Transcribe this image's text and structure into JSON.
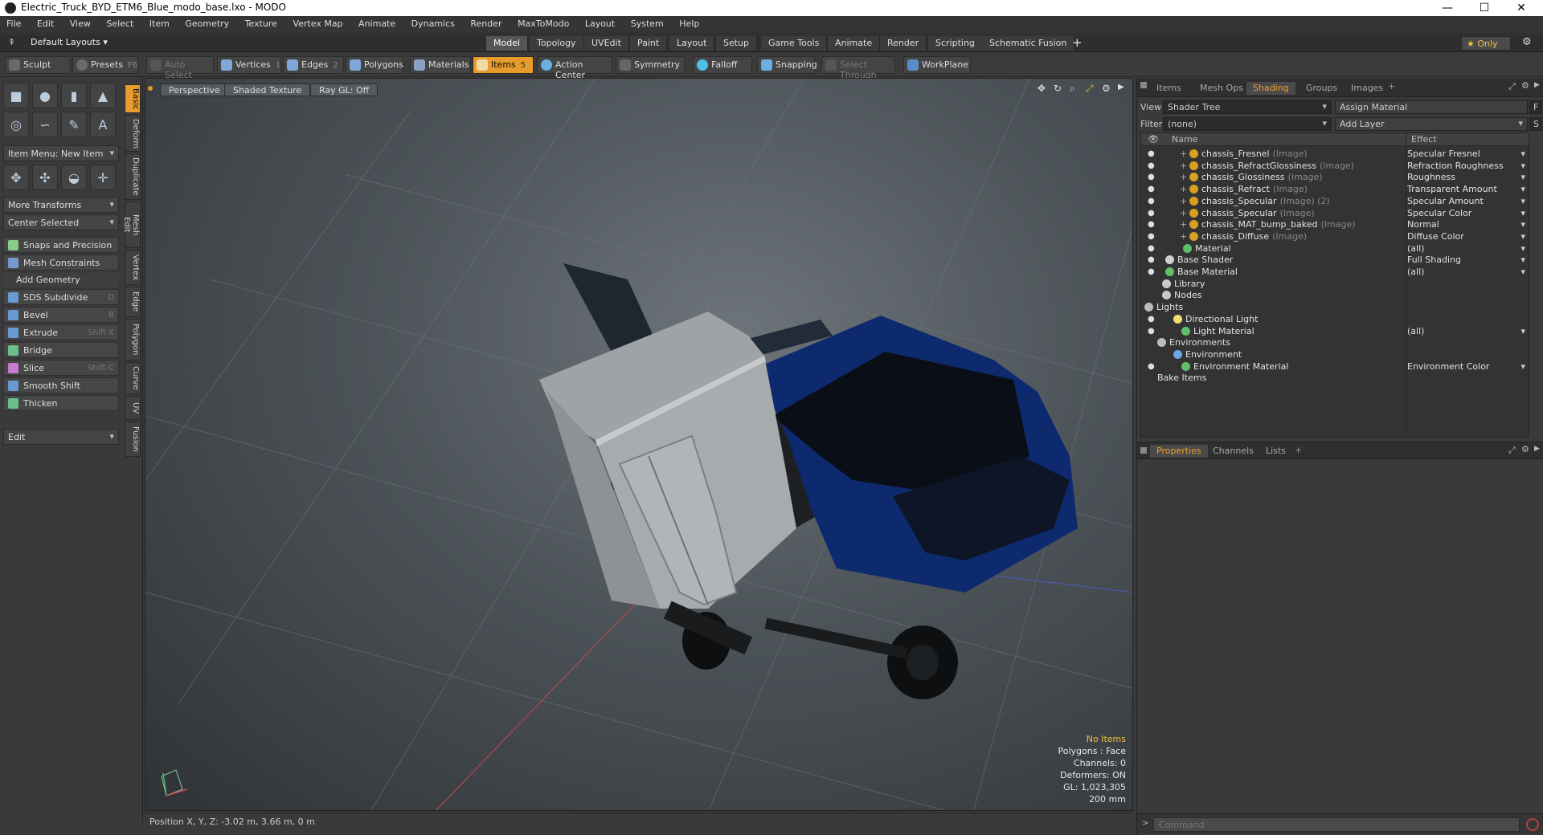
{
  "window": {
    "title": "Electric_Truck_BYD_ETM6_Blue_modo_base.lxo - MODO",
    "minimize": "—",
    "maximize": "☐",
    "close": "✕"
  },
  "menu": [
    "File",
    "Edit",
    "View",
    "Select",
    "Item",
    "Geometry",
    "Texture",
    "Vertex Map",
    "Animate",
    "Dynamics",
    "Render",
    "MaxToModo",
    "Layout",
    "System",
    "Help"
  ],
  "layouts": {
    "selector": "Default Layouts",
    "tabs": [
      "Model",
      "Topology",
      "UVEdit",
      "Paint",
      "Layout",
      "Setup",
      "Game Tools",
      "Animate",
      "Render",
      "Scripting",
      "Schematic Fusion"
    ],
    "active": "Model",
    "add": "+",
    "only": "★ Only"
  },
  "toolbar": {
    "sculpt": "Sculpt",
    "presets": "Presets",
    "presets_key": "F6",
    "auto_select": "Auto Select",
    "vertices": "Vertices",
    "vertices_n": "1",
    "edges": "Edges",
    "edges_n": "2",
    "polygons": "Polygons",
    "materials": "Materials",
    "items": "Items",
    "items_n": "5",
    "action_center": "Action Center",
    "symmetry": "Symmetry",
    "falloff": "Falloff",
    "snapping": "Snapping",
    "select_through": "Select Through",
    "workplane": "WorkPlane"
  },
  "left": {
    "item_menu": "Item Menu: New Item",
    "more_transforms": "More Transforms",
    "center_selected": "Center Selected",
    "snaps": "Snaps and Precision",
    "mesh_constraints": "Mesh Constraints",
    "add_geometry": "Add Geometry",
    "tools": [
      {
        "label": "SDS Subdivide",
        "key": "D"
      },
      {
        "label": "Bevel",
        "key": "B"
      },
      {
        "label": "Extrude",
        "key": "Shift-X"
      },
      {
        "label": "Bridge",
        "key": ""
      },
      {
        "label": "Slice",
        "key": "Shift-C"
      },
      {
        "label": "Smooth Shift",
        "key": ""
      },
      {
        "label": "Thicken",
        "key": ""
      }
    ],
    "edit": "Edit",
    "vtabs": [
      "Basic",
      "Deform",
      "Duplicate",
      "Mesh Edit",
      "Vertex",
      "Edge",
      "Polygon",
      "Curve",
      "UV",
      "Fusion"
    ]
  },
  "viewport": {
    "perspective": "Perspective",
    "shading": "Shaded Texture",
    "raygl": "Ray GL: Off",
    "hud": {
      "no_items": "No Items",
      "polygons": "Polygons : Face",
      "channels": "Channels: 0",
      "deformers": "Deformers: ON",
      "gl": "GL: 1,023,305",
      "scale": "200 mm"
    }
  },
  "status": {
    "position": "Position X, Y, Z:  -3.02 m, 3.66 m, 0 m"
  },
  "right": {
    "tabs": [
      "Items",
      "Mesh Ops",
      "Shading",
      "Groups",
      "Images"
    ],
    "active_tab": "Shading",
    "view_label": "View",
    "view_value": "Shader Tree",
    "assign_material": "Assign Material",
    "f_btn": "F",
    "filter_label": "Filter",
    "filter_value": "(none)",
    "add_layer": "Add Layer",
    "s_btn": "S",
    "col_name": "Name",
    "col_effect": "Effect",
    "rows": [
      {
        "name": "chassis_Fresnel",
        "sub": "(Image)",
        "effect": "Specular Fresnel",
        "eye": true,
        "plus": true,
        "icon": "image"
      },
      {
        "name": "chassis_RefractGlossiness",
        "sub": "(Image)",
        "effect": "Refraction Roughness",
        "eye": true,
        "plus": true,
        "icon": "image"
      },
      {
        "name": "chassis_Glossiness",
        "sub": "(Image)",
        "effect": "Roughness",
        "eye": true,
        "plus": true,
        "icon": "image"
      },
      {
        "name": "chassis_Refract",
        "sub": "(Image)",
        "effect": "Transparent Amount",
        "eye": true,
        "plus": true,
        "icon": "image"
      },
      {
        "name": "chassis_Specular",
        "sub": "(Image) (2)",
        "effect": "Specular Amount",
        "eye": true,
        "plus": true,
        "icon": "image"
      },
      {
        "name": "chassis_Specular",
        "sub": "(Image)",
        "effect": "Specular Color",
        "eye": true,
        "plus": true,
        "icon": "image"
      },
      {
        "name": "chassis_MAT_bump_baked",
        "sub": "(Image)",
        "effect": "Normal",
        "eye": true,
        "plus": true,
        "icon": "image"
      },
      {
        "name": "chassis_Diffuse",
        "sub": "(Image)",
        "effect": "Diffuse Color",
        "eye": true,
        "plus": true,
        "icon": "image"
      },
      {
        "name": "Material",
        "sub": "",
        "effect": "(all)",
        "eye": true,
        "plus": false,
        "icon": "material"
      },
      {
        "name": "Base Shader",
        "sub": "",
        "effect": "Full Shading",
        "eye": true,
        "plus": false,
        "icon": "shader"
      },
      {
        "name": "Base Material",
        "sub": "",
        "effect": "(all)",
        "eye": true,
        "plus": false,
        "icon": "material"
      },
      {
        "name": "Library",
        "sub": "",
        "effect": "",
        "eye": false,
        "plus": false,
        "icon": "folder"
      },
      {
        "name": "Nodes",
        "sub": "",
        "effect": "",
        "eye": false,
        "plus": false,
        "icon": "folder"
      },
      {
        "name": "Lights",
        "sub": "",
        "effect": "",
        "eye": false,
        "plus": false,
        "icon": "group"
      },
      {
        "name": "Directional Light",
        "sub": "",
        "effect": "",
        "eye": true,
        "plus": false,
        "icon": "light"
      },
      {
        "name": "Light Material",
        "sub": "",
        "effect": "(all)",
        "eye": true,
        "plus": false,
        "icon": "material"
      },
      {
        "name": "Environments",
        "sub": "",
        "effect": "",
        "eye": false,
        "plus": false,
        "icon": "group"
      },
      {
        "name": "Environment",
        "sub": "",
        "effect": "",
        "eye": false,
        "plus": false,
        "icon": "env"
      },
      {
        "name": "Environment Material",
        "sub": "",
        "effect": "Environment Color",
        "eye": true,
        "plus": false,
        "icon": "material"
      },
      {
        "name": "Bake Items",
        "sub": "",
        "effect": "",
        "eye": false,
        "plus": false,
        "icon": "none"
      }
    ],
    "prop_tabs": [
      "Properties",
      "Channels",
      "Lists"
    ],
    "prop_active": "Properties",
    "command_placeholder": "Command"
  },
  "colors": {
    "accent": "#e69b2a",
    "truck_blue": "#0e2a6e",
    "bg": "#3a3a3a"
  }
}
